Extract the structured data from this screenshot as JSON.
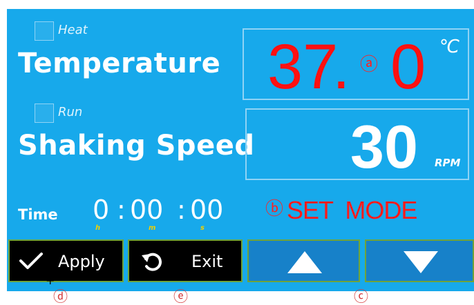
{
  "temperature": {
    "heat_label": "Heat",
    "title": "Temperature",
    "value_int": "37",
    "decimal_point": ".",
    "value_dec": "0",
    "unit": "℃",
    "marker": "ⓐ"
  },
  "shaking": {
    "run_label": "Run",
    "title": "Shaking Speed",
    "value": "30",
    "unit": "RPM"
  },
  "time": {
    "label": "Time",
    "hours": "0",
    "minutes": "00",
    "seconds": "00",
    "separator": ":",
    "h_label": "h",
    "m_label": "m",
    "s_label": "s"
  },
  "mode": {
    "marker": "ⓑ",
    "text": "SET  MODE"
  },
  "buttons": {
    "apply_label": "Apply",
    "exit_label": "Exit"
  },
  "captions": {
    "d": "ⓓ",
    "e": "ⓔ",
    "c": "ⓒ"
  },
  "cursor": "+",
  "colors": {
    "background": "#17a9eb",
    "display_value": "#ff1010",
    "mode_text": "#ff1a1a",
    "button_dark": "#000000",
    "button_blue": "#1781c9",
    "button_border": "#6fa33a"
  },
  "icons": {
    "apply": "checkmark-icon",
    "exit": "undo-arrow-icon",
    "up": "triangle-up-icon",
    "down": "triangle-down-icon"
  }
}
